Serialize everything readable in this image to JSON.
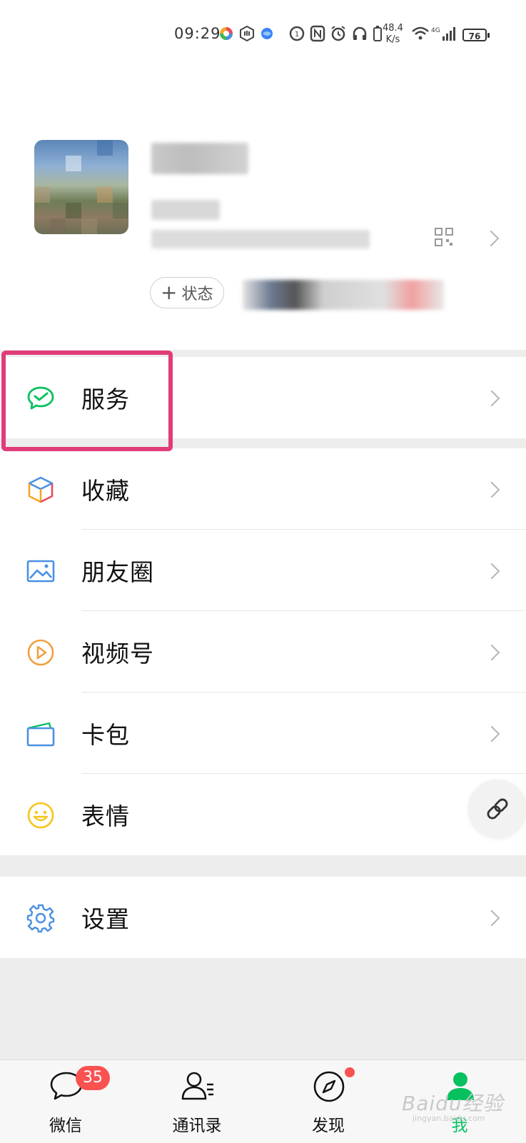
{
  "status_bar": {
    "time": "09:29",
    "net_speed_value": "48.4",
    "net_speed_unit": "K/s",
    "network_label": "4G",
    "battery": "76"
  },
  "profile": {
    "add_status_label": "状态"
  },
  "menu": {
    "services": {
      "label": "服务",
      "icon": "wechat-pay-icon"
    },
    "items": [
      {
        "label": "收藏",
        "icon": "favorites-cube-icon"
      },
      {
        "label": "朋友圈",
        "icon": "moments-image-icon"
      },
      {
        "label": "视频号",
        "icon": "channels-play-icon"
      },
      {
        "label": "卡包",
        "icon": "card-wallet-icon"
      },
      {
        "label": "表情",
        "icon": "smiley-face-icon"
      }
    ],
    "settings": {
      "label": "设置",
      "icon": "gear-icon"
    }
  },
  "tabbar": {
    "tabs": [
      {
        "label": "微信",
        "icon": "chat-bubble-icon",
        "badge": "35"
      },
      {
        "label": "通讯录",
        "icon": "contacts-icon"
      },
      {
        "label": "发现",
        "icon": "compass-icon",
        "dot": true
      },
      {
        "label": "我",
        "icon": "me-person-icon",
        "active": true
      }
    ]
  },
  "watermark": {
    "text": "Baidu经验",
    "sub": "jingyan.baidu.com"
  },
  "colors": {
    "highlight": "#e03c7a",
    "wechat_green": "#07c160",
    "badge_red": "#fa5151",
    "background": "#ededed"
  }
}
